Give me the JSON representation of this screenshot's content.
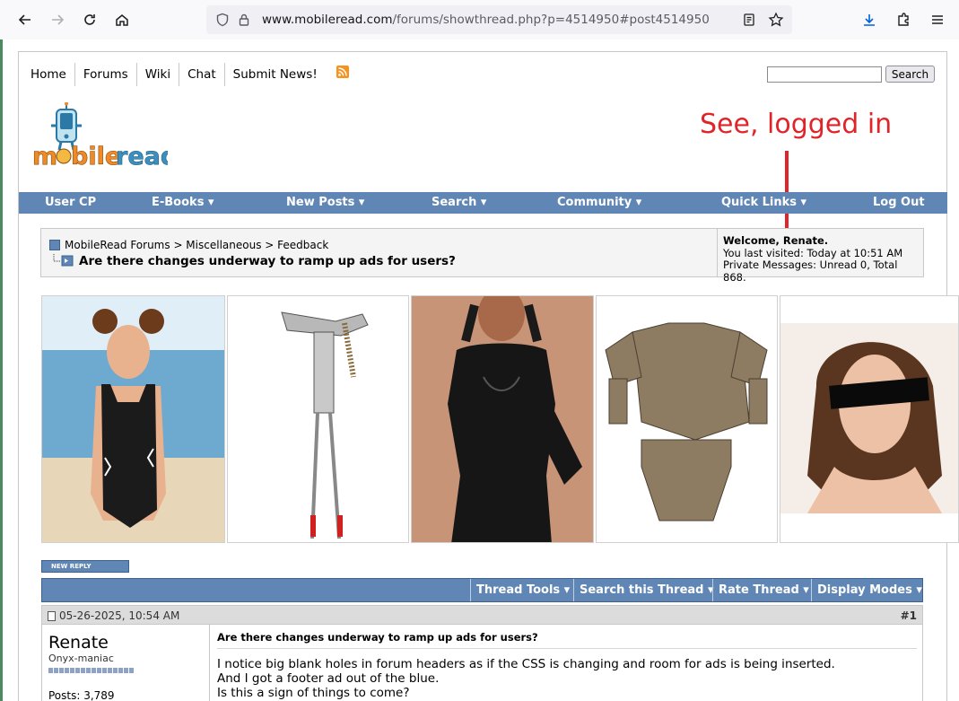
{
  "browser": {
    "url_host": "www.mobileread.com",
    "url_path": "/forums/showthread.php?p=4514950#post4514950"
  },
  "topnav": {
    "items": [
      "Home",
      "Forums",
      "Wiki",
      "Chat",
      "Submit News!"
    ],
    "search_button": "Search",
    "search_value": ""
  },
  "annotation": "See, logged in",
  "menu": [
    "User CP",
    "E-Books ▾",
    "New Posts ▾",
    "Search ▾",
    "Community ▾",
    "Quick Links ▾",
    "Log Out"
  ],
  "breadcrumb": {
    "path": "MobileRead Forums > Miscellaneous > Feedback",
    "title": "Are there changes underway to ramp up ads for users?"
  },
  "welcome": {
    "prefix": "Welcome, ",
    "name": "Renate.",
    "last_visited": "You last visited: Today at 10:51 AM",
    "pm": "Private Messages: Unread 0, Total 868."
  },
  "ads_colors": [
    "#7fb3d6",
    "#ffffff",
    "#c89478",
    "#ffffff",
    "#ffffff"
  ],
  "new_reply": "NEW REPLY",
  "thread_tools": [
    "Thread Tools ▾",
    "Search this Thread ▾",
    "Rate Thread ▾",
    "Display Modes ▾"
  ],
  "post": {
    "date": "05-26-2025, 10:54 AM",
    "number": "#1",
    "username": "Renate",
    "usertitle": "Onyx-maniac",
    "posts": "Posts: 3,789",
    "title": "Are there changes underway to ramp up ads for users?",
    "body": [
      "I notice big blank holes in forum headers as if the CSS is changing and room for ads is being inserted.",
      "And I got a footer ad out of the blue.",
      "Is this a sign of things to come?"
    ]
  },
  "colors": {
    "menu_blue": "#5f86b4",
    "annotation_red": "#e0252a"
  }
}
